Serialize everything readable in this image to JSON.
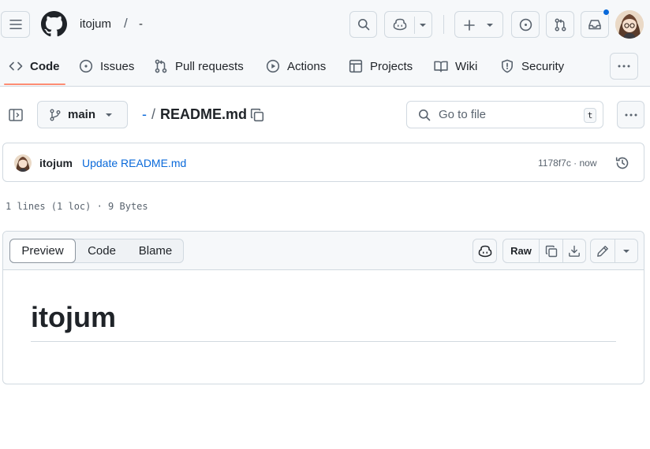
{
  "header": {
    "owner": "itojum",
    "separator": "/",
    "repo": "-",
    "notification_color": "#0969da"
  },
  "tabs": [
    {
      "label": "Code",
      "icon": "code-icon",
      "active": true
    },
    {
      "label": "Issues",
      "icon": "issue-opened-icon"
    },
    {
      "label": "Pull requests",
      "icon": "git-pull-request-icon"
    },
    {
      "label": "Actions",
      "icon": "play-icon"
    },
    {
      "label": "Projects",
      "icon": "table-icon"
    },
    {
      "label": "Wiki",
      "icon": "book-icon"
    },
    {
      "label": "Security",
      "icon": "shield-icon"
    }
  ],
  "filebar": {
    "branch": "main",
    "path_root": "-",
    "path_sep": "/",
    "file_name": "README.md",
    "search_placeholder": "Go to file",
    "search_shortcut": "t"
  },
  "commit": {
    "author": "itojum",
    "message": "Update README.md",
    "sha_time": "1178f7c · now"
  },
  "file_meta": "1 lines (1 loc) · 9 Bytes",
  "viewer": {
    "tabs": [
      "Preview",
      "Code",
      "Blame"
    ],
    "active_tab": "Preview",
    "raw_label": "Raw"
  },
  "readme": {
    "heading": "itojum"
  },
  "colors": {
    "accent": "#0969da",
    "tab_underline": "#fd8c73"
  }
}
